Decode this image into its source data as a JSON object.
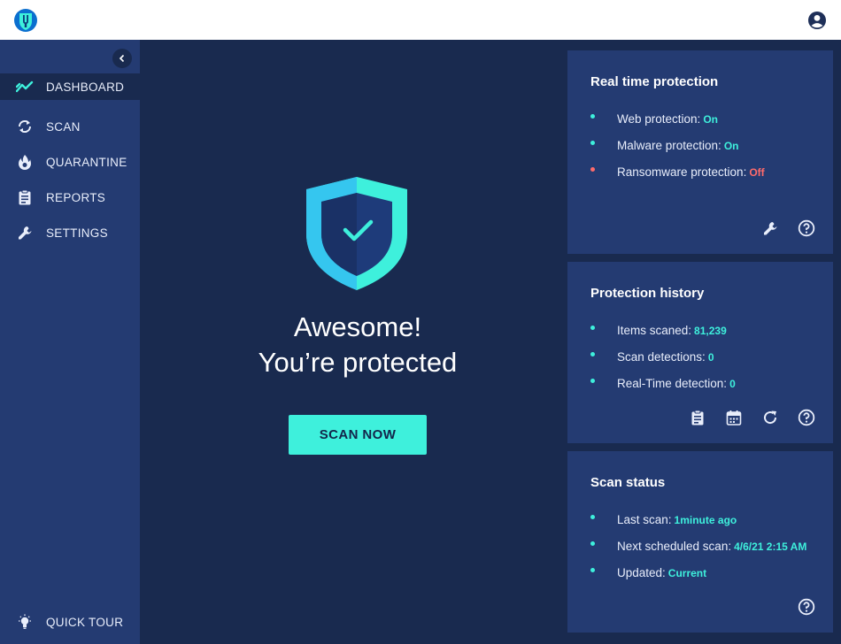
{
  "colors": {
    "accent": "#3ef0dc",
    "danger": "#ff6b6b",
    "sidebar": "#243b72",
    "background": "#192a4f"
  },
  "header": {
    "logo_icon": "shield-logo-icon",
    "user_icon": "user-account-icon"
  },
  "sidebar": {
    "collapse_icon": "chevron-left-icon",
    "items": [
      {
        "label": "DASHBOARD",
        "icon": "trend-icon",
        "active": true
      },
      {
        "label": "SCAN",
        "icon": "refresh-icon",
        "active": false
      },
      {
        "label": "QUARANTINE",
        "icon": "flame-icon",
        "active": false
      },
      {
        "label": "REPORTS",
        "icon": "clipboard-icon",
        "active": false
      },
      {
        "label": "SETTINGS",
        "icon": "wrench-icon",
        "active": false
      }
    ],
    "quick_tour": {
      "label": "QUICK TOUR",
      "icon": "lightbulb-icon"
    }
  },
  "hero": {
    "shield_icon": "shield-check-icon",
    "line1": "Awesome!",
    "line2": "You’re protected",
    "button": "SCAN NOW"
  },
  "real_time": {
    "title": "Real time protection",
    "items": [
      {
        "label": "Web protection:",
        "value": "On",
        "status": "ok"
      },
      {
        "label": "Malware protection:",
        "value": "On",
        "status": "ok"
      },
      {
        "label": "Ransomware protection:",
        "value": "Off",
        "status": "off"
      }
    ],
    "actions": [
      "wrench-icon",
      "help-icon"
    ]
  },
  "history": {
    "title": "Protection history",
    "items": [
      {
        "label": "Items scaned:",
        "value": "81,239"
      },
      {
        "label": "Scan detections:",
        "value": "0"
      },
      {
        "label": "Real-Time detection:",
        "value": "0"
      }
    ],
    "actions": [
      "clipboard-icon",
      "calendar-icon",
      "refresh-icon",
      "help-icon"
    ]
  },
  "scan_status": {
    "title": "Scan status",
    "items": [
      {
        "label": "Last scan:",
        "value": "1minute ago"
      },
      {
        "label": "Next scheduled scan:",
        "value": "4/6/21 2:15 AM"
      },
      {
        "label": "Updated:",
        "value": "Current"
      }
    ],
    "actions": [
      "help-icon"
    ]
  }
}
